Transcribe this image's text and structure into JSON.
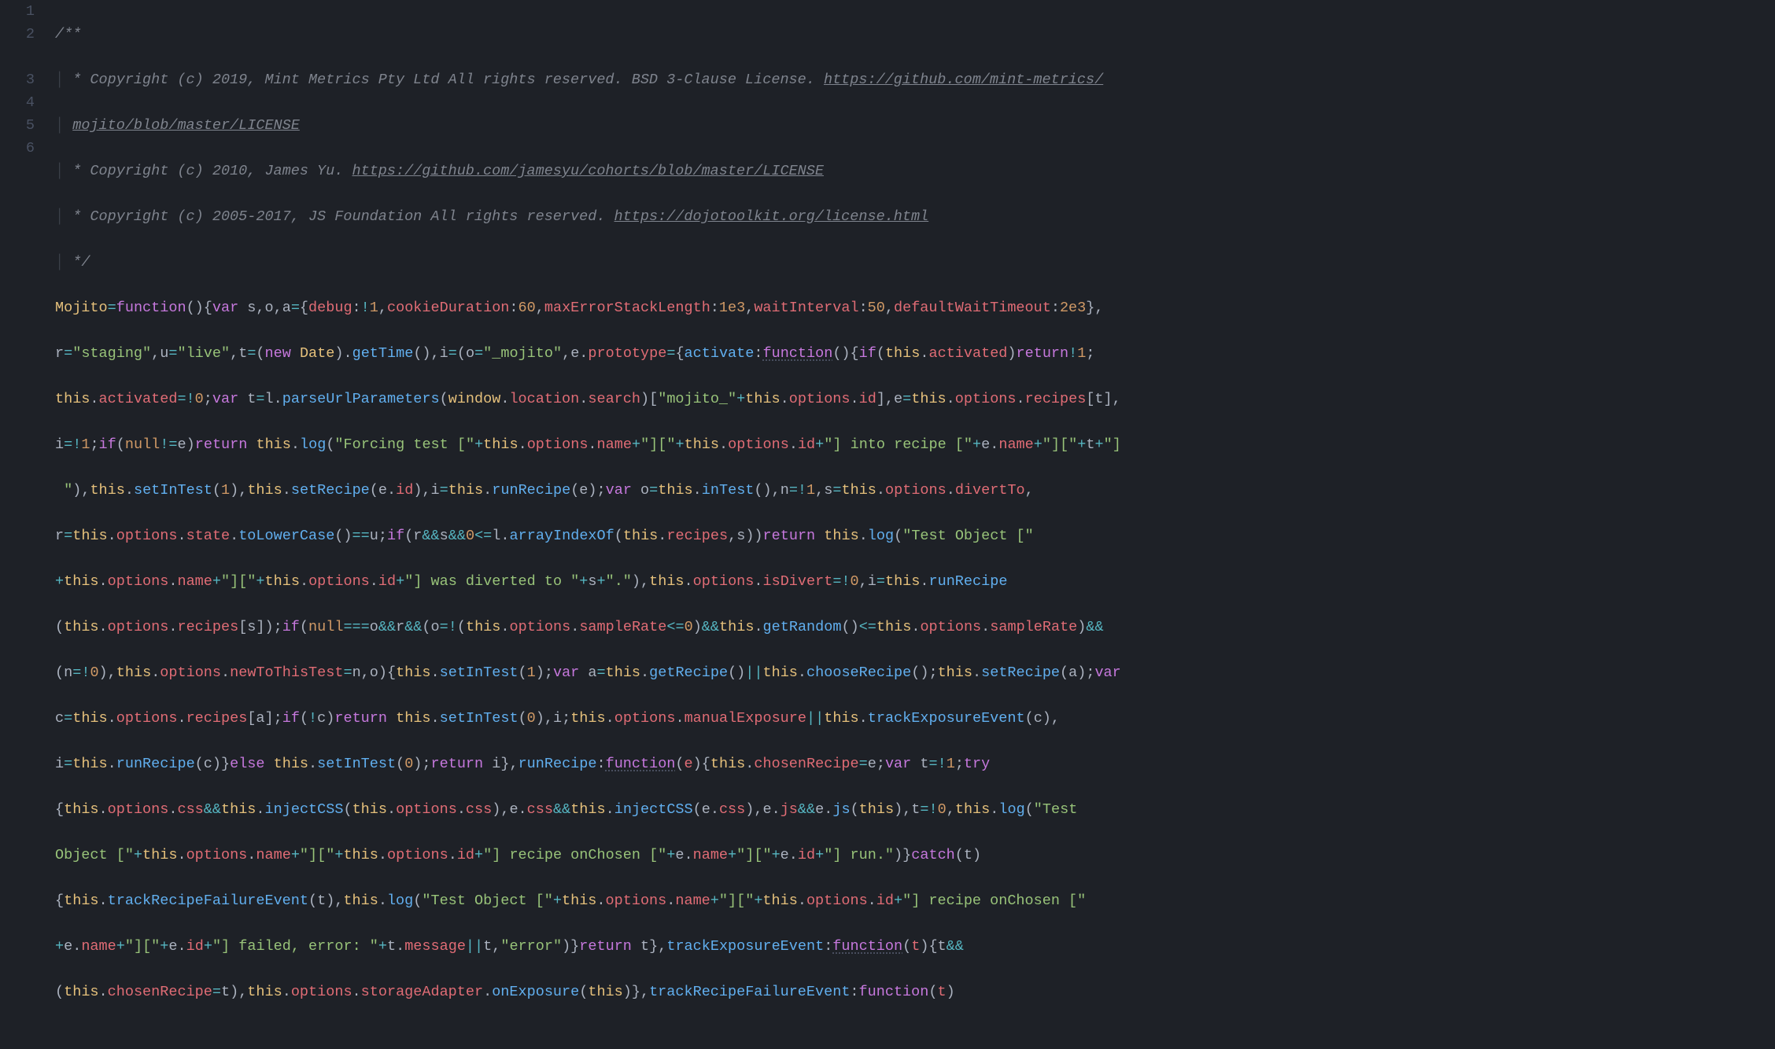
{
  "gutter": [
    "1",
    "2",
    "",
    "3",
    "4",
    "5",
    "6",
    "",
    "",
    "",
    "",
    "",
    "",
    "",
    "",
    "",
    "",
    "",
    "",
    "",
    "",
    ""
  ],
  "code": {
    "l1": "/**",
    "l2a": " * Copyright (c) 2019, Mint Metrics Pty Ltd All rights reserved. BSD 3-Clause License. ",
    "l2link": "https://github.com/mint-metrics/",
    "l2b": "mojito/blob/master/LICENSE",
    "l3a": " * Copyright (c) 2010, James Yu. ",
    "l3link": "https://github.com/jamesyu/cohorts/blob/master/LICENSE",
    "l4a": " * Copyright (c) 2005-2017, JS Foundation All rights reserved. ",
    "l4link": "https://dojotoolkit.org/license.html",
    "l5": " */",
    "l6": {
      "mojito": "Mojito",
      "func": "function",
      "var": "var",
      "debug": "debug",
      "cookieDuration": "cookieDuration",
      "cd_val": "60",
      "maxErr": "maxErrorStackLength",
      "maxErr_val": "1e3",
      "waitInt": "waitInterval",
      "waitInt_val": "50",
      "defWait": "defaultWaitTimeout",
      "defWait_val": "2e3"
    },
    "l7": {
      "staging": "\"staging\"",
      "live": "\"live\"",
      "new": "new",
      "Date": "Date",
      "getTime": "getTime",
      "mojito": "\"_mojito\"",
      "prototype": "prototype",
      "activate": "activate",
      "function": "function",
      "if": "if",
      "this": "this",
      "activated": "activated",
      "return": "return"
    },
    "l8": {
      "this": "this",
      "activated": "activated",
      "var": "var",
      "parseUrl": "parseUrlParameters",
      "window": "window",
      "location": "location",
      "search": "search",
      "mojito": "\"mojito_\"",
      "options": "options",
      "id": "id",
      "recipes": "recipes"
    },
    "l9": {
      "if": "if",
      "null": "null",
      "return": "return",
      "this": "this",
      "log": "log",
      "forcing": "\"Forcing test [\"",
      "options": "options",
      "name": "name",
      "br1": "\"][\"",
      "id": "id",
      "into": "\"] into recipe [\"",
      "t": "\"][\"+t+\"]"
    },
    "l10": {
      "close": " \"",
      "this": "this",
      "setInTest": "setInTest",
      "setRecipe": "setRecipe",
      "id": "id",
      "runRecipe": "runRecipe",
      "var": "var",
      "inTest": "inTest",
      "options": "options",
      "divertTo": "divertTo"
    },
    "l11": {
      "this": "this",
      "options": "options",
      "state": "state",
      "toLowerCase": "toLowerCase",
      "if": "if",
      "arrayIndexOf": "arrayIndexOf",
      "recipes": "recipes",
      "return": "return",
      "log": "log",
      "testobj": "\"Test Object [\""
    },
    "l12": {
      "this": "this",
      "options": "options",
      "name": "name",
      "br": "\"][\"",
      "id": "id",
      "diverted": "\"] was diverted to \"",
      "dot": "\".\"",
      "isDivert": "isDivert",
      "runRecipe": "runRecipe"
    },
    "l13": {
      "this": "this",
      "options": "options",
      "recipes": "recipes",
      "if": "if",
      "null": "null",
      "sampleRate": "sampleRate",
      "getRandom": "getRandom"
    },
    "l14": {
      "this": "this",
      "options": "options",
      "newToThisTest": "newToThisTest",
      "setInTest": "setInTest",
      "var": "var",
      "getRecipe": "getRecipe",
      "chooseRecipe": "chooseRecipe",
      "setRecipe": "setRecipe"
    },
    "l15": {
      "this": "this",
      "options": "options",
      "recipes": "recipes",
      "if": "if",
      "return": "return",
      "setInTest": "setInTest",
      "manualExposure": "manualExposure",
      "trackExposureEvent": "trackExposureEvent"
    },
    "l16": {
      "this": "this",
      "runRecipe": "runRecipe",
      "else": "else",
      "setInTest": "setInTest",
      "return": "return",
      "function": "function",
      "chosenRecipe": "chosenRecipe",
      "var": "var",
      "try": "try"
    },
    "l17": {
      "this": "this",
      "options": "options",
      "css": "css",
      "injectCSS": "injectCSS",
      "js": "js",
      "log": "log",
      "test": "\"Test "
    },
    "l18": {
      "objstr": "Object [\"",
      "this": "this",
      "options": "options",
      "name": "name",
      "br": "\"][\"",
      "id": "id",
      "recipe": "\"] recipe onChosen [\"",
      "run": "\"] run.\"",
      "catch": "catch"
    },
    "l19": {
      "this": "this",
      "trackRecipeFailureEvent": "trackRecipeFailureEvent",
      "log": "log",
      "testobj": "\"Test Object [\"",
      "options": "options",
      "name": "name",
      "br": "\"][\"",
      "id": "id",
      "recipe": "\"] recipe onChosen [\""
    },
    "l20": {
      "name": "name",
      "br": "\"][\"",
      "id": "id",
      "failed": "\"] failed, error: \"",
      "message": "message",
      "error": "\"error\"",
      "return": "return",
      "trackExposureEvent": "trackExposureEvent",
      "function": "function"
    },
    "l21": {
      "this": "this",
      "chosenRecipe": "chosenRecipe",
      "options": "options",
      "storageAdapter": "storageAdapter",
      "onExposure": "onExposure",
      "trackRecipeFailureEvent": "trackRecipeFailureEvent",
      "function": "function"
    }
  }
}
